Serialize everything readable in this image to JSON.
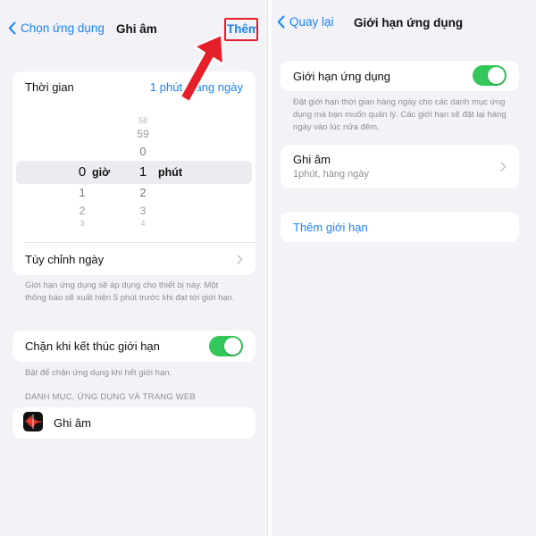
{
  "left": {
    "navbar": {
      "back_label": "Chọn ứng dụng",
      "title": "Ghi âm",
      "add_label": "Thêm"
    },
    "time": {
      "label": "Thời gian",
      "value": "1 phút, hàng ngày"
    },
    "picker": {
      "hours_unit": "giờ",
      "minutes_unit": "phút",
      "hours": [
        "0",
        "1",
        "2",
        "3"
      ],
      "minutes": [
        "58",
        "59",
        "0",
        "1",
        "2",
        "3",
        "4"
      ]
    },
    "custom_days": {
      "label": "Tùy chỉnh ngày"
    },
    "limit_note": "Giới hạn ứng dụng sẽ áp dụng cho thiết bị này. Một thông báo sẽ xuất hiện 5 phút trước khi đạt tới giới hạn.",
    "block": {
      "label": "Chặn khi kết thúc giới hạn",
      "on": true
    },
    "block_note": "Bật để chặn ứng dụng khi hết giới hạn.",
    "section_header": "DANH MỤC, ỨNG DỤNG VÀ TRANG WEB",
    "app": {
      "name": "Ghi âm",
      "icon": "voice-memos-icon"
    }
  },
  "right": {
    "navbar": {
      "back_label": "Quay lại",
      "title": "Giới hạn ứng dụng"
    },
    "app_limits": {
      "label": "Giới hạn ứng dụng",
      "on": true
    },
    "app_limits_note": "Đặt giới hạn thời gian hàng ngày cho các danh mục ứng dụng mà bạn muốn quản lý. Các giới hạn sẽ đặt lại hàng ngày vào lúc nửa đêm.",
    "limit_item": {
      "title": "Ghi âm",
      "subtitle": "1phút, hàng ngày"
    },
    "add_limit_label": "Thêm giới hạn"
  },
  "colors": {
    "accent": "#1a84ff",
    "toggle_on": "#34c759",
    "highlight": "#e5202a",
    "background": "#f2f2f7"
  }
}
